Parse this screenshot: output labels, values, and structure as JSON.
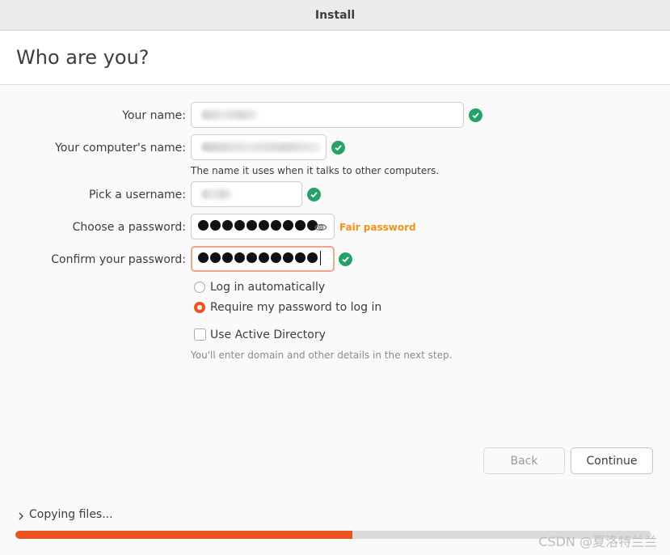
{
  "window": {
    "title": "Install"
  },
  "page": {
    "title": "Who are you?"
  },
  "form": {
    "name_label": "Your name:",
    "computer_label": "Your computer's name:",
    "computer_hint": "The name it uses when it talks to other computers.",
    "username_label": "Pick a username:",
    "password_label": "Choose a password:",
    "password_strength": "Fair password",
    "confirm_label": "Confirm your password:",
    "password_length": 10,
    "confirm_length": 10
  },
  "login_options": {
    "auto_label": "Log in automatically",
    "require_label": "Require my password to log in",
    "selected": "require"
  },
  "active_directory": {
    "label": "Use Active Directory",
    "checked": false,
    "hint": "You'll enter domain and other details in the next step."
  },
  "buttons": {
    "back": "Back",
    "continue": "Continue"
  },
  "progress": {
    "label": "Copying files...",
    "fraction": 0.53
  },
  "watermark": "CSDN @夏洛特兰兰",
  "colors": {
    "accent": "#e95420",
    "success": "#26a269",
    "warning": "#f29419"
  },
  "icons": {
    "valid": "check-circle-icon",
    "reveal": "eye-icon",
    "expander": "chevron-right-icon"
  }
}
